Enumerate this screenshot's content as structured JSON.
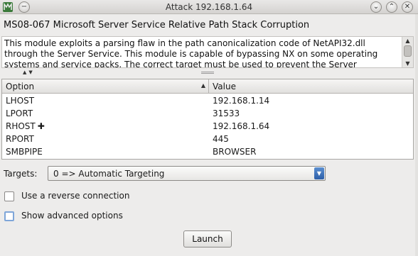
{
  "window": {
    "title": "Attack 192.168.1.64",
    "app_icon": "metasploit-icon",
    "buttons": [
      {
        "name": "minimize",
        "glyph": "⌄"
      },
      {
        "name": "maximize",
        "glyph": "⌃"
      },
      {
        "name": "close",
        "glyph": "✕"
      }
    ]
  },
  "module": {
    "title": "MS08-067 Microsoft Server Service Relative Path Stack Corruption",
    "description": "This module exploits a parsing flaw in the path canonicalization code of NetAPI32.dll through the Server Service. This module is capable of bypassing NX on some operating systems and service packs. The correct target must be used to prevent the Server"
  },
  "options_table": {
    "columns": [
      "Option",
      "Value"
    ],
    "rows": [
      {
        "option": "LHOST",
        "value": "192.168.1.14",
        "marker": ""
      },
      {
        "option": "LPORT",
        "value": "31533",
        "marker": ""
      },
      {
        "option": "RHOST",
        "value": "192.168.1.64",
        "marker": "✚"
      },
      {
        "option": "RPORT",
        "value": "445",
        "marker": ""
      },
      {
        "option": "SMBPIPE",
        "value": "BROWSER",
        "marker": ""
      }
    ]
  },
  "targets": {
    "label": "Targets:",
    "selected": "0 => Automatic Targeting"
  },
  "checkboxes": {
    "reverse_connection": {
      "label": "Use a reverse connection",
      "checked": false
    },
    "advanced_options": {
      "label": "Show advanced options",
      "checked": false
    }
  },
  "launch_label": "Launch"
}
